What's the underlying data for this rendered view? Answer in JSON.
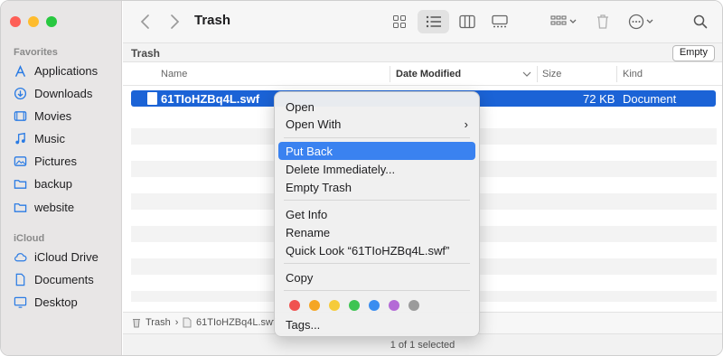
{
  "window": {
    "title": "Trash"
  },
  "colors": {
    "close": "#fe5f57",
    "minimize": "#febc2e",
    "zoom": "#28c840",
    "accent": "#1b63d6",
    "highlight": "#3a82f0"
  },
  "sidebar": {
    "favorites_label": "Favorites",
    "icloud_label": "iCloud",
    "favorites": [
      {
        "label": "Applications",
        "icon": "applications-icon"
      },
      {
        "label": "Downloads",
        "icon": "downloads-icon"
      },
      {
        "label": "Movies",
        "icon": "movies-icon"
      },
      {
        "label": "Music",
        "icon": "music-icon"
      },
      {
        "label": "Pictures",
        "icon": "pictures-icon"
      },
      {
        "label": "backup",
        "icon": "folder-icon"
      },
      {
        "label": "website",
        "icon": "folder-icon"
      }
    ],
    "icloud": [
      {
        "label": "iCloud Drive",
        "icon": "cloud-icon"
      },
      {
        "label": "Documents",
        "icon": "document-icon"
      },
      {
        "label": "Desktop",
        "icon": "desktop-icon"
      }
    ]
  },
  "pathbar": {
    "label": "Trash",
    "empty_button": "Empty"
  },
  "columns": {
    "name": "Name",
    "date_modified": "Date Modified",
    "size": "Size",
    "kind": "Kind"
  },
  "file": {
    "name": "61TIoHZBq4L.swf",
    "size": "72 KB",
    "kind": "Document"
  },
  "footer": {
    "crumb1": "Trash",
    "crumb2": "61TIoHZBq4L.swf",
    "status": "1 of 1 selected"
  },
  "context_menu": {
    "open": "Open",
    "open_with": "Open With",
    "put_back": "Put Back",
    "delete_immediately": "Delete Immediately...",
    "empty_trash": "Empty Trash",
    "get_info": "Get Info",
    "rename": "Rename",
    "quick_look": "Quick Look “61TIoHZBq4L.swf”",
    "copy": "Copy",
    "tags": "Tags...",
    "tag_colors": [
      "#f0524f",
      "#f5a623",
      "#f6cb3a",
      "#3ec452",
      "#3b8df0",
      "#b46ad6",
      "#9b9b9b"
    ]
  }
}
